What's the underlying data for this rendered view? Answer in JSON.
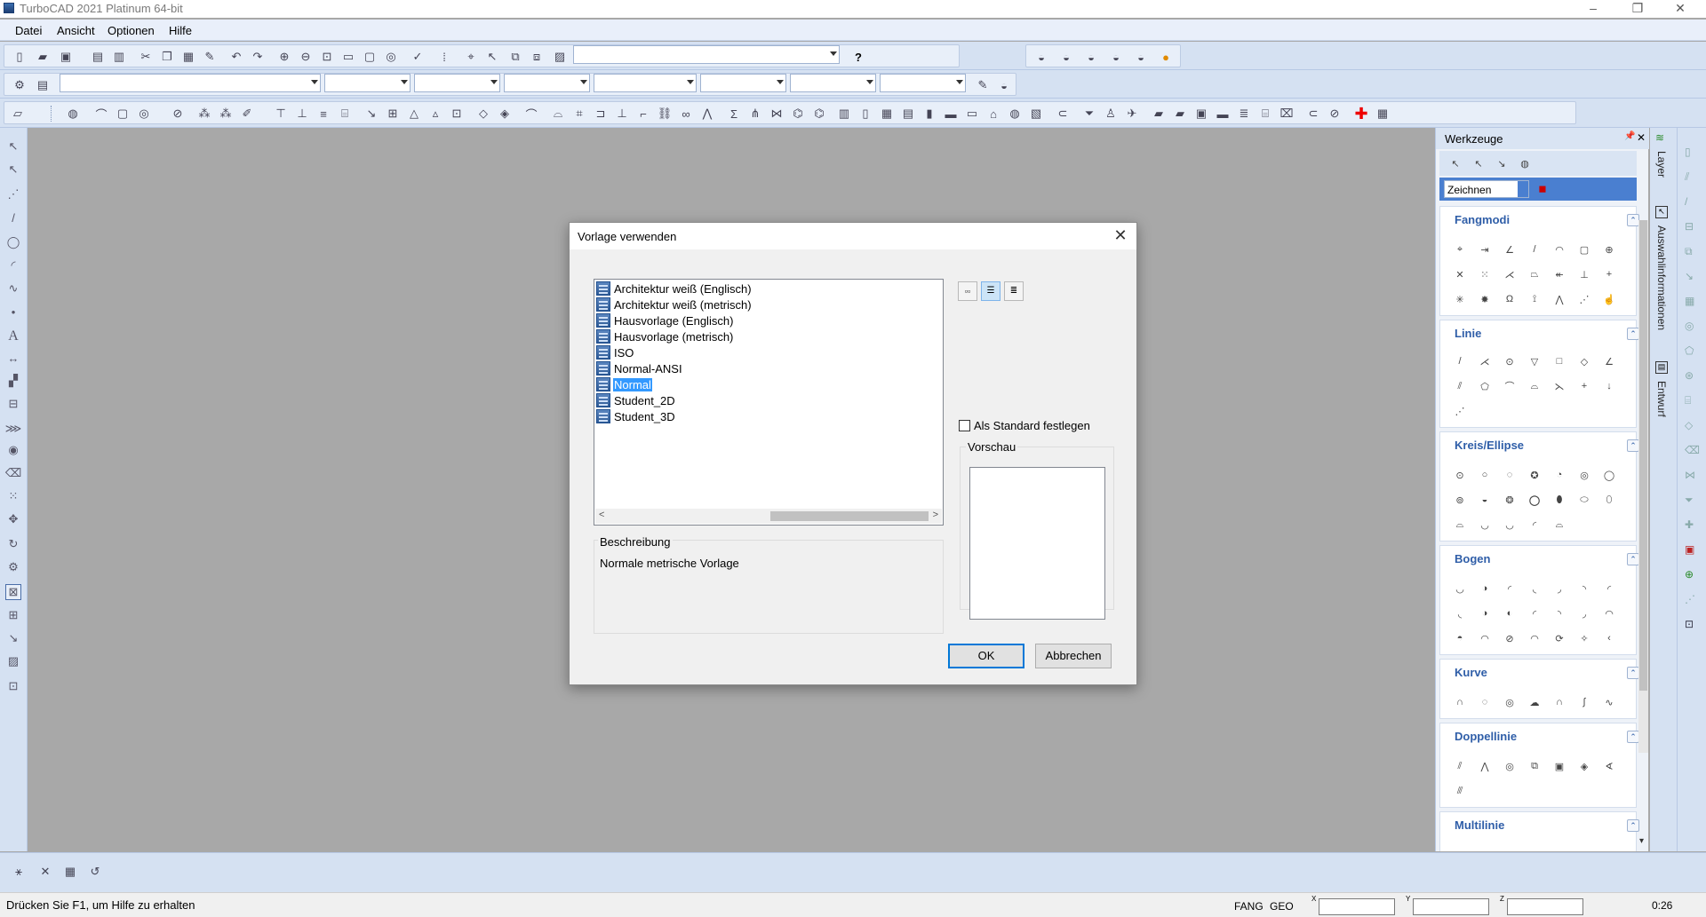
{
  "window": {
    "title": "TurboCAD 2021 Platinum 64-bit",
    "minimize_glyph": "–",
    "restore_glyph": "❐",
    "close_glyph": "✕"
  },
  "menu": [
    "Datei",
    "Ansicht",
    "Optionen",
    "Hilfe"
  ],
  "toolbar": {
    "help_glyph": "?"
  },
  "dialog": {
    "title": "Vorlage verwenden",
    "close_glyph": "✕",
    "templates": [
      {
        "label": "Architektur weiß (Englisch)",
        "selected": false
      },
      {
        "label": "Architektur weiß (metrisch)",
        "selected": false
      },
      {
        "label": "Hausvorlage (Englisch)",
        "selected": false
      },
      {
        "label": "Hausvorlage (metrisch)",
        "selected": false
      },
      {
        "label": "ISO",
        "selected": false
      },
      {
        "label": "Normal-ANSI",
        "selected": false
      },
      {
        "label": "Normal",
        "selected": true
      },
      {
        "label": "Student_2D",
        "selected": false
      },
      {
        "label": "Student_3D",
        "selected": false
      }
    ],
    "set_default_label": "Als Standard festlegen",
    "preview_label": "Vorschau",
    "description_label": "Beschreibung",
    "description_text": "Normale metrische Vorlage",
    "ok_label": "OK",
    "cancel_label": "Abbrechen",
    "view_icons": [
      "large-icons-view-icon",
      "list-view-icon",
      "details-view-icon"
    ]
  },
  "right_panel": {
    "title": "Werkzeuge",
    "pin_glyph": "📌",
    "close_glyph": "✕",
    "dropdown_value": "Zeichnen",
    "sections": [
      {
        "title": "Fangmodi",
        "rows": 3
      },
      {
        "title": "Linie",
        "rows": 3
      },
      {
        "title": "Kreis/Ellipse",
        "rows": 3
      },
      {
        "title": "Bogen",
        "rows": 3
      },
      {
        "title": "Kurve",
        "rows": 1
      },
      {
        "title": "Doppellinie",
        "rows": 2
      },
      {
        "title": "Multilinie",
        "rows": 0
      }
    ],
    "side_tabs": [
      "Layer",
      "Auswahlinformationen",
      "Entwurf"
    ]
  },
  "status": {
    "help_text": "Drücken Sie F1, um Hilfe zu erhalten",
    "fang": "FANG",
    "geo": "GEO",
    "coord_x_label": "X",
    "coord_y_label": "Y",
    "coord_z_label": "Z",
    "time": "0:26"
  },
  "colors": {
    "accent": "#0078d7",
    "selection": "#3399ff",
    "section_title": "#2f5ea8",
    "toolbar_bg": "#d5e1f2",
    "workspace_bg": "#a8a8a8"
  }
}
